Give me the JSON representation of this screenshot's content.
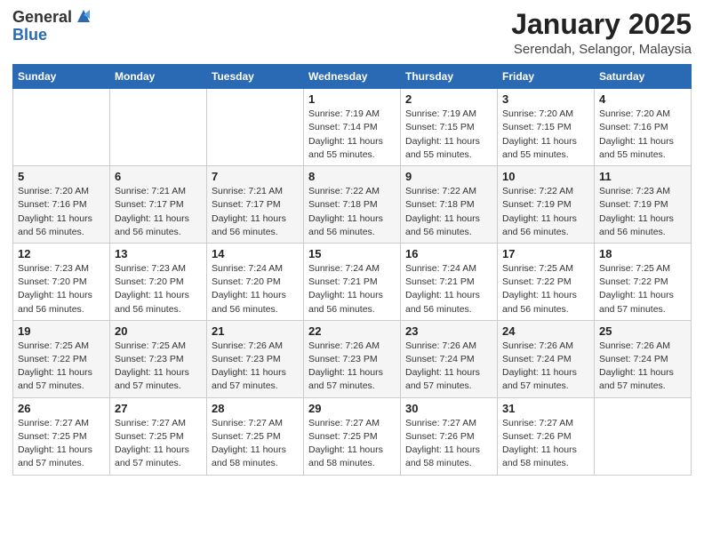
{
  "logo": {
    "general": "General",
    "blue": "Blue"
  },
  "title": {
    "main": "January 2025",
    "sub": "Serendah, Selangor, Malaysia"
  },
  "days_of_week": [
    "Sunday",
    "Monday",
    "Tuesday",
    "Wednesday",
    "Thursday",
    "Friday",
    "Saturday"
  ],
  "weeks": [
    [
      {
        "day": "",
        "info": ""
      },
      {
        "day": "",
        "info": ""
      },
      {
        "day": "",
        "info": ""
      },
      {
        "day": "1",
        "info": "Sunrise: 7:19 AM\nSunset: 7:14 PM\nDaylight: 11 hours\nand 55 minutes."
      },
      {
        "day": "2",
        "info": "Sunrise: 7:19 AM\nSunset: 7:15 PM\nDaylight: 11 hours\nand 55 minutes."
      },
      {
        "day": "3",
        "info": "Sunrise: 7:20 AM\nSunset: 7:15 PM\nDaylight: 11 hours\nand 55 minutes."
      },
      {
        "day": "4",
        "info": "Sunrise: 7:20 AM\nSunset: 7:16 PM\nDaylight: 11 hours\nand 55 minutes."
      }
    ],
    [
      {
        "day": "5",
        "info": "Sunrise: 7:20 AM\nSunset: 7:16 PM\nDaylight: 11 hours\nand 56 minutes."
      },
      {
        "day": "6",
        "info": "Sunrise: 7:21 AM\nSunset: 7:17 PM\nDaylight: 11 hours\nand 56 minutes."
      },
      {
        "day": "7",
        "info": "Sunrise: 7:21 AM\nSunset: 7:17 PM\nDaylight: 11 hours\nand 56 minutes."
      },
      {
        "day": "8",
        "info": "Sunrise: 7:22 AM\nSunset: 7:18 PM\nDaylight: 11 hours\nand 56 minutes."
      },
      {
        "day": "9",
        "info": "Sunrise: 7:22 AM\nSunset: 7:18 PM\nDaylight: 11 hours\nand 56 minutes."
      },
      {
        "day": "10",
        "info": "Sunrise: 7:22 AM\nSunset: 7:19 PM\nDaylight: 11 hours\nand 56 minutes."
      },
      {
        "day": "11",
        "info": "Sunrise: 7:23 AM\nSunset: 7:19 PM\nDaylight: 11 hours\nand 56 minutes."
      }
    ],
    [
      {
        "day": "12",
        "info": "Sunrise: 7:23 AM\nSunset: 7:20 PM\nDaylight: 11 hours\nand 56 minutes."
      },
      {
        "day": "13",
        "info": "Sunrise: 7:23 AM\nSunset: 7:20 PM\nDaylight: 11 hours\nand 56 minutes."
      },
      {
        "day": "14",
        "info": "Sunrise: 7:24 AM\nSunset: 7:20 PM\nDaylight: 11 hours\nand 56 minutes."
      },
      {
        "day": "15",
        "info": "Sunrise: 7:24 AM\nSunset: 7:21 PM\nDaylight: 11 hours\nand 56 minutes."
      },
      {
        "day": "16",
        "info": "Sunrise: 7:24 AM\nSunset: 7:21 PM\nDaylight: 11 hours\nand 56 minutes."
      },
      {
        "day": "17",
        "info": "Sunrise: 7:25 AM\nSunset: 7:22 PM\nDaylight: 11 hours\nand 56 minutes."
      },
      {
        "day": "18",
        "info": "Sunrise: 7:25 AM\nSunset: 7:22 PM\nDaylight: 11 hours\nand 57 minutes."
      }
    ],
    [
      {
        "day": "19",
        "info": "Sunrise: 7:25 AM\nSunset: 7:22 PM\nDaylight: 11 hours\nand 57 minutes."
      },
      {
        "day": "20",
        "info": "Sunrise: 7:25 AM\nSunset: 7:23 PM\nDaylight: 11 hours\nand 57 minutes."
      },
      {
        "day": "21",
        "info": "Sunrise: 7:26 AM\nSunset: 7:23 PM\nDaylight: 11 hours\nand 57 minutes."
      },
      {
        "day": "22",
        "info": "Sunrise: 7:26 AM\nSunset: 7:23 PM\nDaylight: 11 hours\nand 57 minutes."
      },
      {
        "day": "23",
        "info": "Sunrise: 7:26 AM\nSunset: 7:24 PM\nDaylight: 11 hours\nand 57 minutes."
      },
      {
        "day": "24",
        "info": "Sunrise: 7:26 AM\nSunset: 7:24 PM\nDaylight: 11 hours\nand 57 minutes."
      },
      {
        "day": "25",
        "info": "Sunrise: 7:26 AM\nSunset: 7:24 PM\nDaylight: 11 hours\nand 57 minutes."
      }
    ],
    [
      {
        "day": "26",
        "info": "Sunrise: 7:27 AM\nSunset: 7:25 PM\nDaylight: 11 hours\nand 57 minutes."
      },
      {
        "day": "27",
        "info": "Sunrise: 7:27 AM\nSunset: 7:25 PM\nDaylight: 11 hours\nand 57 minutes."
      },
      {
        "day": "28",
        "info": "Sunrise: 7:27 AM\nSunset: 7:25 PM\nDaylight: 11 hours\nand 58 minutes."
      },
      {
        "day": "29",
        "info": "Sunrise: 7:27 AM\nSunset: 7:25 PM\nDaylight: 11 hours\nand 58 minutes."
      },
      {
        "day": "30",
        "info": "Sunrise: 7:27 AM\nSunset: 7:26 PM\nDaylight: 11 hours\nand 58 minutes."
      },
      {
        "day": "31",
        "info": "Sunrise: 7:27 AM\nSunset: 7:26 PM\nDaylight: 11 hours\nand 58 minutes."
      },
      {
        "day": "",
        "info": ""
      }
    ]
  ]
}
